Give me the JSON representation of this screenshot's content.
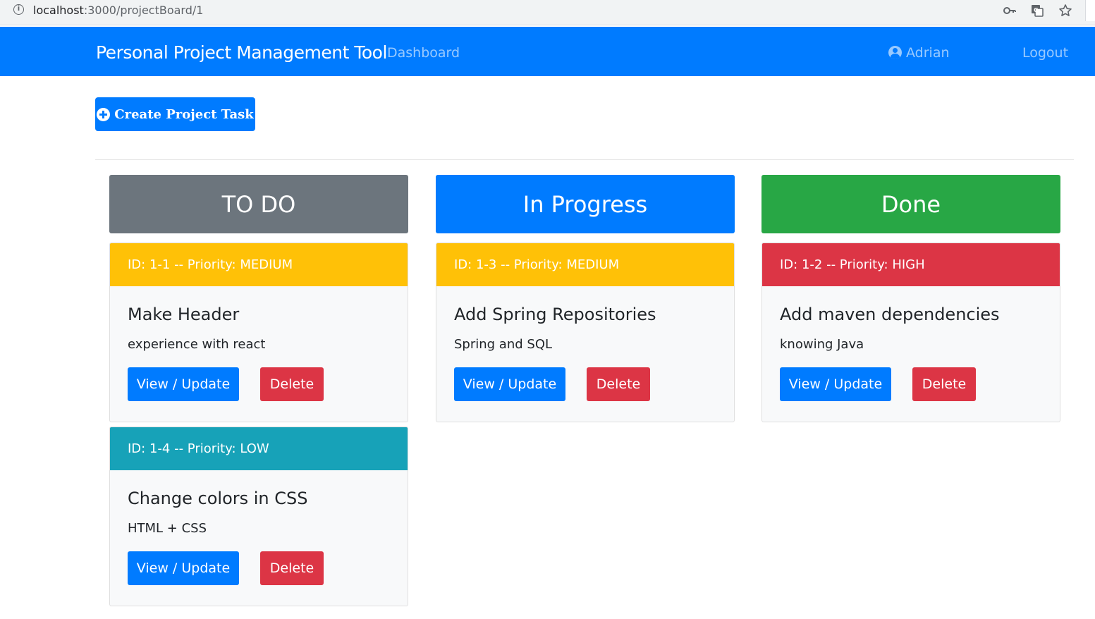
{
  "browser": {
    "url_host": "localhost",
    "url_rest": ":3000/projectBoard/1"
  },
  "navbar": {
    "brand": "Personal Project Management Tool",
    "dashboard": "Dashboard",
    "user": "Adrian",
    "logout": "Logout"
  },
  "create_button": "Create Project Task",
  "columns": [
    {
      "title": "TO DO",
      "color": "#6c757d",
      "tasks": [
        {
          "header": "ID: 1-1 -- Priority: MEDIUM",
          "priority_color": "#ffc107",
          "title": "Make Header",
          "description": "experience with react",
          "view_label": "View / Update",
          "delete_label": "Delete"
        },
        {
          "header": "ID: 1-4 -- Priority: LOW",
          "priority_color": "#17a2b8",
          "title": "Change colors in CSS",
          "description": "HTML + CSS",
          "view_label": "View / Update",
          "delete_label": "Delete"
        }
      ]
    },
    {
      "title": "In Progress",
      "color": "#007bff",
      "tasks": [
        {
          "header": "ID: 1-3 -- Priority: MEDIUM",
          "priority_color": "#ffc107",
          "title": "Add Spring Repositories",
          "description": "Spring and SQL",
          "view_label": "View / Update",
          "delete_label": "Delete"
        }
      ]
    },
    {
      "title": "Done",
      "color": "#28a745",
      "tasks": [
        {
          "header": "ID: 1-2 -- Priority: HIGH",
          "priority_color": "#dc3545",
          "title": "Add maven dependencies",
          "description": "knowing Java",
          "view_label": "View / Update",
          "delete_label": "Delete"
        }
      ]
    }
  ]
}
